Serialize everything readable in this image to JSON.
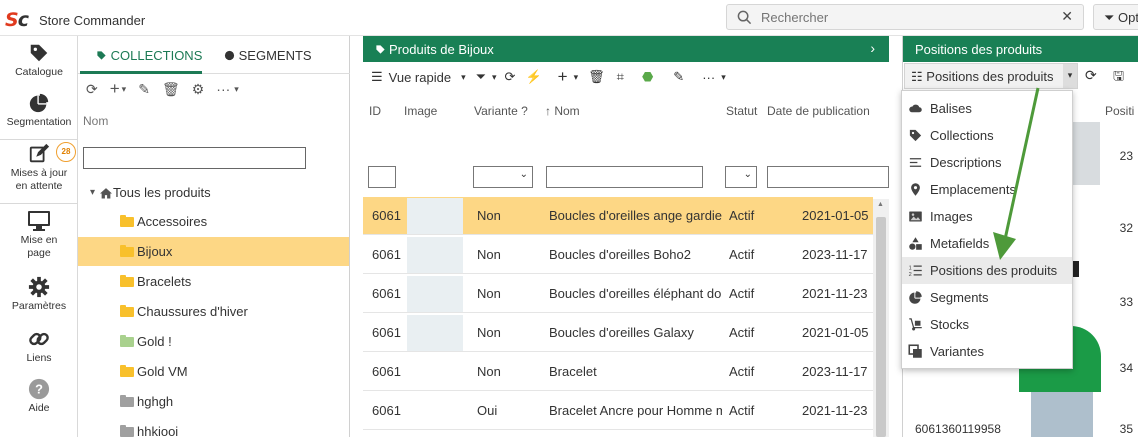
{
  "app": {
    "title": "Store Commander",
    "logo_s": "S",
    "logo_c": "c"
  },
  "search": {
    "placeholder": "Rechercher",
    "clear": "✕",
    "options_label": "Opt"
  },
  "rail": {
    "catalogue": "Catalogue",
    "segmentation": "Segmentation",
    "updates_l1": "Mises à jour",
    "updates_l2": "en attente",
    "updates_badge": "28",
    "layout_l1": "Mise en",
    "layout_l2": "page",
    "params": "Paramètres",
    "links": "Liens",
    "help": "Aide"
  },
  "collections": {
    "tab_collections": "COLLECTIONS",
    "tab_segments": "SEGMENTS",
    "filter_label": "Nom",
    "toolbar_more": "···",
    "root": "Tous les produits",
    "items": [
      {
        "label": "Accessoires",
        "color": "yellow"
      },
      {
        "label": "Bijoux",
        "color": "yellow"
      },
      {
        "label": "Bracelets",
        "color": "yellow"
      },
      {
        "label": "Chaussures d'hiver",
        "color": "yellow"
      },
      {
        "label": "Gold !",
        "color": "green"
      },
      {
        "label": "Gold VM",
        "color": "yellow"
      },
      {
        "label": "hghgh",
        "color": "grey"
      },
      {
        "label": "hhkiooi",
        "color": "grey"
      }
    ],
    "selected_index": 1
  },
  "products": {
    "header": "Produits de Bijoux",
    "view_label": "Vue rapide",
    "toolbar_more": "···",
    "columns": {
      "id": "ID",
      "image": "Image",
      "variant": "Variante ?",
      "name": "Nom",
      "status": "Statut",
      "date": "Date de publication"
    },
    "rows": [
      {
        "id": "6061",
        "variant": "Non",
        "name": "Boucles d'oreilles ange gardien",
        "status": "Actif",
        "date": "2021-01-05"
      },
      {
        "id": "6061",
        "variant": "Non",
        "name": "Boucles d'oreilles Boho2",
        "status": "Actif",
        "date": "2023-11-17"
      },
      {
        "id": "6061",
        "variant": "Non",
        "name": "Boucles d'oreilles éléphant doré",
        "status": "Actif",
        "date": "2021-11-23"
      },
      {
        "id": "6061",
        "variant": "Non",
        "name": "Boucles d'oreilles Galaxy",
        "status": "Actif",
        "date": "2021-01-05"
      },
      {
        "id": "6061",
        "variant": "Non",
        "name": "Bracelet",
        "status": "Actif",
        "date": "2023-11-17"
      },
      {
        "id": "6061",
        "variant": "Oui",
        "name": "Bracelet Ancre pour Homme m",
        "status": "Actif",
        "date": "2021-11-23"
      }
    ],
    "selected_index": 0
  },
  "positions": {
    "header": "Positions des produits",
    "select_value": "Positions des produits",
    "col_position": "Positi",
    "rows": [
      {
        "id": "",
        "pos": "23"
      },
      {
        "id": "",
        "pos": "32"
      },
      {
        "id": "",
        "pos": "33"
      },
      {
        "id": "",
        "pos": "34"
      },
      {
        "id": "6061360119958",
        "pos": "35"
      }
    ],
    "dropdown": [
      {
        "label": "Balises",
        "icon": "cloud-icon"
      },
      {
        "label": "Collections",
        "icon": "tag-icon"
      },
      {
        "label": "Descriptions",
        "icon": "align-left-icon"
      },
      {
        "label": "Emplacements",
        "icon": "map-pin-icon"
      },
      {
        "label": "Images",
        "icon": "image-icon"
      },
      {
        "label": "Metafields",
        "icon": "shapes-icon"
      },
      {
        "label": "Positions des produits",
        "icon": "sort-list-icon"
      },
      {
        "label": "Segments",
        "icon": "pie-chart-icon"
      },
      {
        "label": "Stocks",
        "icon": "dolly-icon"
      },
      {
        "label": "Variantes",
        "icon": "clone-icon"
      }
    ],
    "dropdown_selected_index": 6
  },
  "colors": {
    "brand_green": "#198055",
    "selection": "#fdd785",
    "logo_red": "#e03a1e",
    "annotation_arrow": "#4e9a3a"
  }
}
